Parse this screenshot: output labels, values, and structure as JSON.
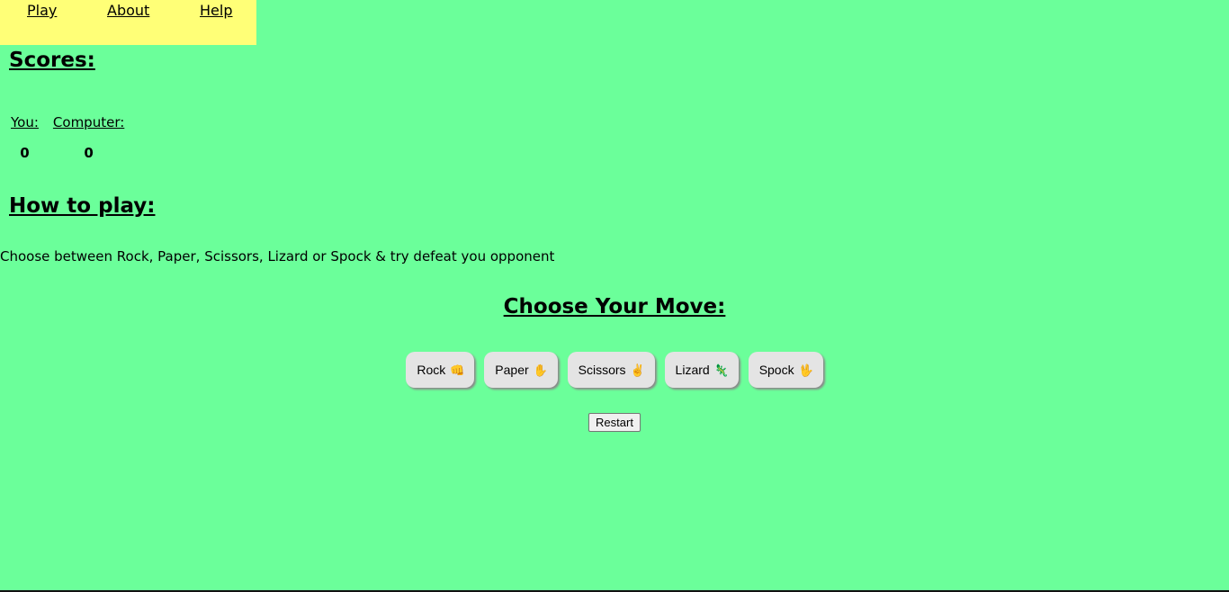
{
  "nav": {
    "play": "Play",
    "about": "About",
    "help": "Help"
  },
  "scores": {
    "title": "Scores:",
    "you_label": "You:",
    "computer_label": "Computer:",
    "you_value": "0",
    "computer_value": "0"
  },
  "how_to_play": {
    "title": "How to play:",
    "text": "Choose between Rock, Paper, Scissors, Lizard or Spock & try defeat you opponent"
  },
  "moves": {
    "title": "Choose Your Move:",
    "buttons": [
      {
        "label": "Rock",
        "emoji": "👊",
        "icon": "fist-icon"
      },
      {
        "label": "Paper",
        "emoji": "✋",
        "icon": "hand-icon"
      },
      {
        "label": "Scissors",
        "emoji": "✌",
        "icon": "victory-hand-icon"
      },
      {
        "label": "Lizard",
        "emoji": "🦎",
        "icon": "lizard-icon"
      },
      {
        "label": "Spock",
        "emoji": "🖖",
        "icon": "vulcan-salute-icon"
      }
    ]
  },
  "restart_label": "Restart",
  "colors": {
    "background": "#6bff9a",
    "nav_background": "#ffff77",
    "button_background": "#e4e4e4"
  }
}
